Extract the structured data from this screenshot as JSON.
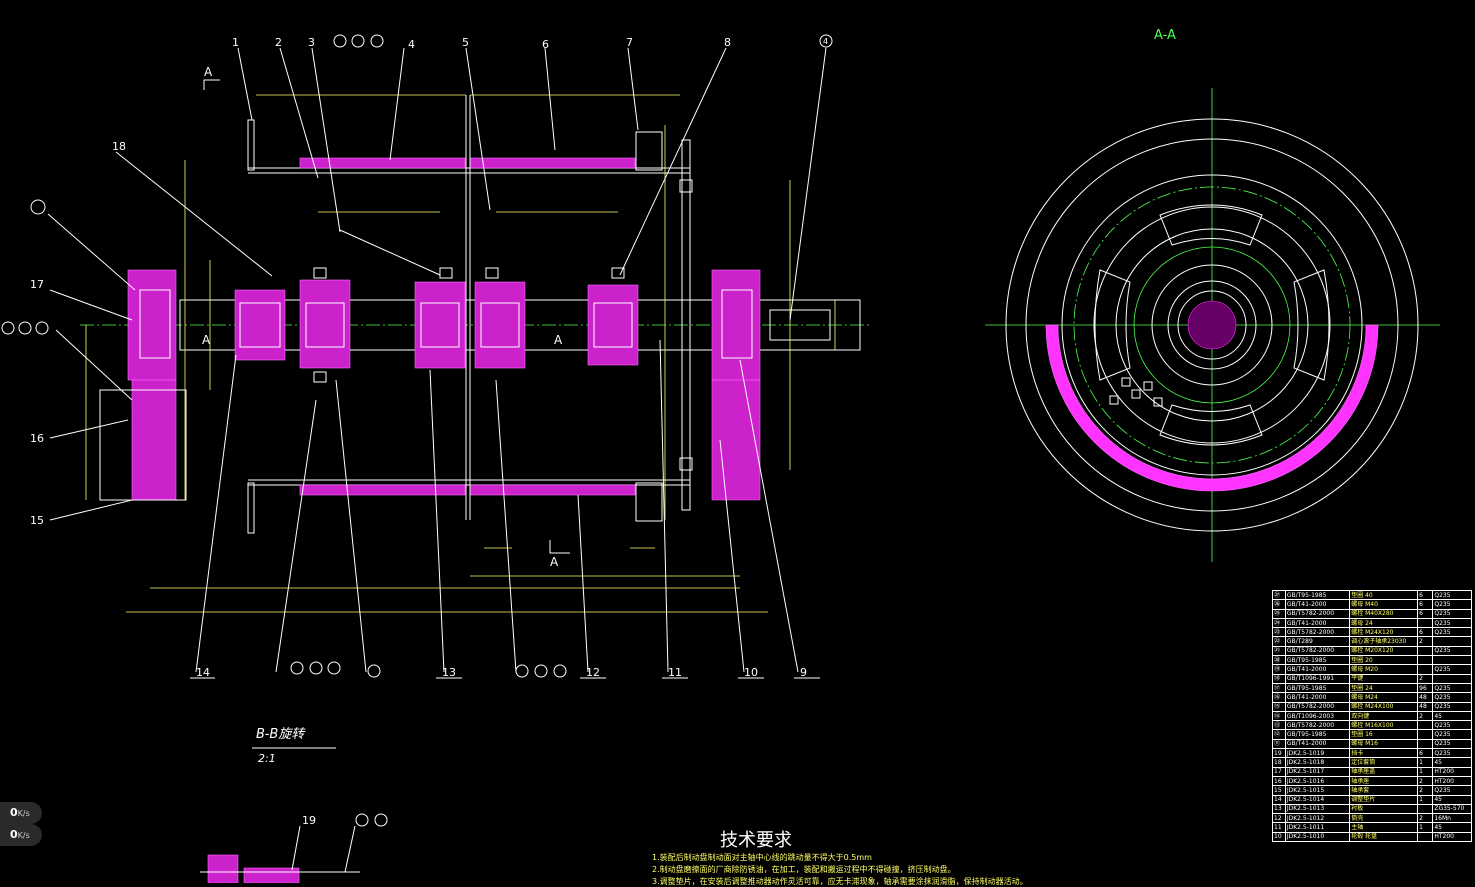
{
  "view_labels": {
    "section_a_top": "A",
    "section_a_left": "A",
    "section_a_mid": "A",
    "section_a_bottom": "A",
    "view_aa": "A-A"
  },
  "callouts_top": [
    "1",
    "2",
    "3",
    "4",
    "5",
    "6",
    "7",
    "8"
  ],
  "callouts_right": [
    "4"
  ],
  "callouts_left": [
    "18",
    "17",
    "16",
    "15"
  ],
  "balloon_groups": {
    "top": [
      "①",
      "②",
      "③"
    ],
    "left": [
      "⑮",
      "⑯",
      "⑰"
    ],
    "bottom_a": [
      "⑨",
      "⑩",
      "⑪"
    ],
    "bottom_b": [
      "⑧"
    ],
    "bottom_c": [
      "⑤",
      "⑥",
      "⑦"
    ],
    "left_18": "⑱",
    "detail": "⑬ ⑭"
  },
  "callouts_bottom": [
    "14",
    "13",
    "12",
    "11",
    "10",
    "9"
  ],
  "detail_callout": "19",
  "section_bb": {
    "title": "B-B旋转",
    "scale": "2:1"
  },
  "tech_requirements": {
    "title": "技术要求",
    "lines": [
      "1.装配后制动盘制动面对主轴中心线的跳动量不得大于0.5mm",
      "2.制动盘磨擦面的厂商除防锈油，在加工，装配和搬运过程中不得碰撞，挤压制动盘。",
      "3.调整垫片，在安装后调整推动器动作灵活可靠，应无卡滞现象，轴承需要涂抹润滑脂，保持制动器活动。"
    ]
  },
  "bom": [
    [
      "㉗",
      "GB/T95-1985",
      "垫圈 40",
      "6",
      "Q235"
    ],
    [
      "㉖",
      "GB/T41-2000",
      "螺母 M40",
      "6",
      "Q235"
    ],
    [
      "㉕",
      "GB/T5782-2000",
      "螺栓 M40X280",
      "6",
      "Q235"
    ],
    [
      "㉔",
      "GB/T41-2000",
      "螺母 24",
      "",
      "Q235"
    ],
    [
      "㉓",
      "GB/T5782-2000",
      "螺栓 M24X120",
      "6",
      "Q235"
    ],
    [
      "㉒",
      "GB/T289",
      "调心滚子轴承23030",
      "2",
      ""
    ],
    [
      "㉑",
      "GB/T5782-2000",
      "螺栓 M20X120",
      "",
      "Q235"
    ],
    [
      "⑳",
      "GB/T95-1985",
      "垫圈 20",
      "",
      ""
    ],
    [
      "⑲",
      "GB/T41-2000",
      "螺母 M20",
      "",
      "Q235"
    ],
    [
      "⑱",
      "GB/T1096-1991",
      "平键",
      "2",
      ""
    ],
    [
      "⑰",
      "GB/T95-1985",
      "垫圈 24",
      "96",
      "Q235"
    ],
    [
      "⑯",
      "GB/T41-2000",
      "螺母 M24",
      "48",
      "Q235"
    ],
    [
      "⑮",
      "GB/T5782-2000",
      "螺栓 M24X100",
      "48",
      "Q235"
    ],
    [
      "⑭",
      "GB/T1096-2003",
      "双向键",
      "2",
      "45"
    ],
    [
      "⑬",
      "GB/T5782-2000",
      "螺栓 M16X100",
      "",
      "Q235"
    ],
    [
      "⑫",
      "GB/T95-1985",
      "垫圈 16",
      "",
      "Q235"
    ],
    [
      "⑪",
      "GB/T41-2000",
      "螺母 M16",
      "",
      "Q235"
    ],
    [
      "19",
      "JDK2.5-1019",
      "挡卡",
      "6",
      "Q235"
    ],
    [
      "18",
      "JDK2.5-1018",
      "定位套筒",
      "1",
      "45"
    ],
    [
      "17",
      "JDK2.5-1017",
      "轴承座盖",
      "1",
      "HT200"
    ],
    [
      "16",
      "JDK2.5-1016",
      "轴承座",
      "2",
      "HT200"
    ],
    [
      "15",
      "JDK2.5-1015",
      "轴承套",
      "2",
      "Q235"
    ],
    [
      "14",
      "JDK2.5-1014",
      "调整垫片",
      "1",
      "45"
    ],
    [
      "13",
      "JDK2.5-1013",
      "衬板",
      "",
      "ZG35-570"
    ],
    [
      "12",
      "JDK2.5-1012",
      "筒壳",
      "2",
      "16Mn"
    ],
    [
      "11",
      "JDK2.5-1011",
      "主轴",
      "1",
      "45"
    ],
    [
      "10",
      "JDK2.5-1010",
      "轮毂 轮盘",
      "",
      "HT200"
    ]
  ],
  "speed_indicators": [
    {
      "value": "0",
      "unit": "K/s"
    },
    {
      "value": "0",
      "unit": "K/s"
    }
  ],
  "colors": {
    "background": "#000000",
    "line": "#ffffff",
    "dimension": "#ffff66",
    "centerline": "#4cff4c",
    "hatch": "#ff33ff"
  }
}
